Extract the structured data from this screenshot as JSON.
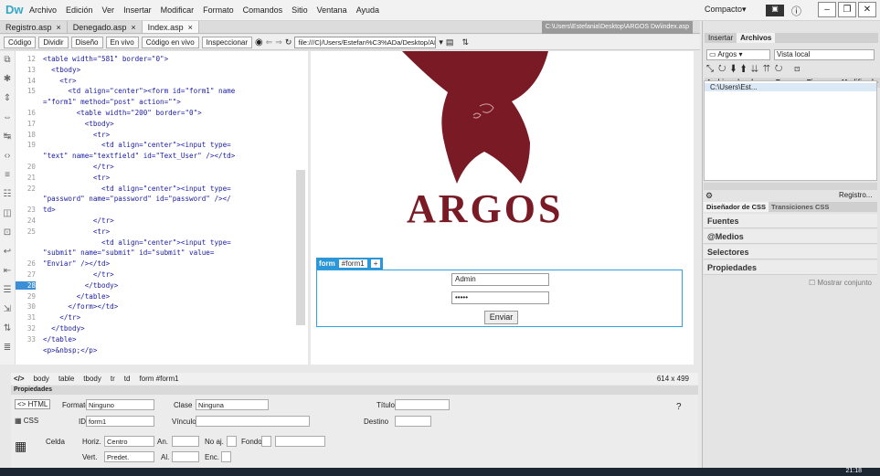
{
  "app": {
    "logo": "Dw",
    "menus": [
      "Archivo",
      "Edición",
      "Ver",
      "Insertar",
      "Modificar",
      "Formato",
      "Comandos",
      "Sitio",
      "Ventana",
      "Ayuda"
    ],
    "layout": "Compacto"
  },
  "tabs": [
    "Registro.asp",
    "Denegado.asp",
    "Index.asp"
  ],
  "path": "C:\\Users\\Estefania\\Desktop\\ARGOS Dw\\index.asp",
  "toolbar": {
    "codigo": "Código",
    "dividir": "Dividir",
    "diseno": "Diseño",
    "envivo": "En vivo",
    "codigo_vivo": "Código en vivo",
    "inspeccionar": "Inspeccionar",
    "url": "file:///C|/Users/Estefan%C3%ADa/Desktop/AR"
  },
  "code": {
    "lines": [
      "12",
      "13",
      "14",
      "15",
      "",
      "16",
      "17",
      "18",
      "19",
      "",
      "20",
      "21",
      "22",
      "",
      "23",
      "24",
      "25",
      "",
      "",
      "26",
      "27",
      "28",
      "29",
      "30",
      "31",
      "32",
      "33"
    ],
    "text": [
      "<table width=\"581\" border=\"0\">",
      "  <tbody>",
      "    <tr>",
      "      <td align=\"center\"><form id=\"form1\" name",
      "=\"form1\" method=\"post\" action=\"\">",
      "        <table width=\"200\" border=\"0\">",
      "          <tbody>",
      "            <tr>",
      "              <td align=\"center\"><input type=",
      "\"text\" name=\"textfield\" id=\"Text_User\" /></td>",
      "            </tr>",
      "            <tr>",
      "              <td align=\"center\"><input type=",
      "\"password\" name=\"password\" id=\"password\" /></",
      "td>",
      "            </tr>",
      "            <tr>",
      "              <td align=\"center\"><input type=",
      "\"submit\" name=\"submit\" id=\"submit\" value=",
      "\"Enviar\" /></td>",
      "            </tr>",
      "          </tbody>",
      "        </table>",
      "      </form></td>",
      "    </tr>",
      "  </tbody>",
      "</table>",
      "<p>&nbsp;</p>"
    ]
  },
  "design": {
    "brand": "ARGOS",
    "form_tag": "form",
    "form_id": "#form1",
    "user_value": "Admin",
    "password_value": "•••••",
    "submit_label": "Enviar"
  },
  "status": {
    "tags": [
      "body",
      "table",
      "tbody",
      "tr",
      "td",
      "form #form1"
    ],
    "size": "614 x 499"
  },
  "right_panel": {
    "tab_insertar": "Insertar",
    "tab_archivos": "Archivos",
    "site": "Argos",
    "view": "Vista local",
    "cols": [
      "Archivos locales",
      "Tam...",
      "Tipo",
      "Modificado"
    ],
    "root": "C:\\Users\\Est...",
    "registro": "Registro...",
    "css_tab": "Diseñador de CSS",
    "trans_tab": "Transiciones CSS",
    "sections": [
      "Fuentes",
      "@Medios",
      "Selectores",
      "Propiedades"
    ],
    "mostrar": "Mostrar conjunto"
  },
  "properties": {
    "title": "Propiedades",
    "html": "HTML",
    "css": "CSS",
    "formato_label": "Formato",
    "formato": "Ninguno",
    "clase_label": "Clase",
    "clase": "Ninguna",
    "titulo_label": "Título",
    "id_label": "ID",
    "id": "form1",
    "vinculo_label": "Vínculo",
    "destino_label": "Destino",
    "celda": "Celda",
    "horz_label": "Horiz.",
    "horz": "Centro",
    "vert_label": "Vert.",
    "vert": "Predet.",
    "an_label": "An.",
    "al_label": "Al.",
    "noaj_label": "No aj.",
    "fondo_label": "Fondo",
    "enc_label": "Enc."
  },
  "taskbar": {
    "time": "21:18"
  }
}
